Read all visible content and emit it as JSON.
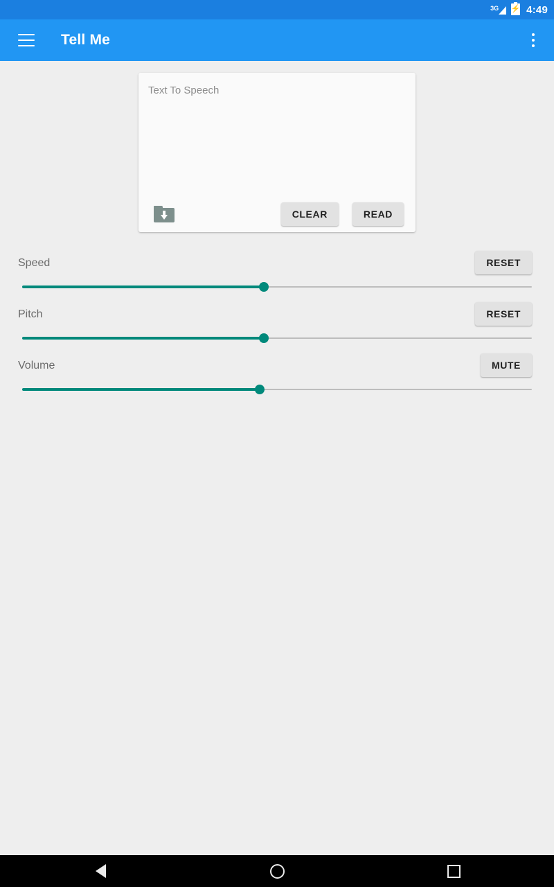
{
  "status_bar": {
    "network_label": "3G",
    "network_icon": "signal-3g-icon",
    "battery_icon": "battery-charging-icon",
    "time": "4:49",
    "background_color": "#1b7fe0"
  },
  "app_bar": {
    "menu_icon": "hamburger-menu-icon",
    "title": "Tell Me",
    "overflow_icon": "overflow-menu-icon",
    "background_color": "#2196f3"
  },
  "card": {
    "input": {
      "placeholder": "Text To Speech",
      "value": ""
    },
    "load_icon": "folder-download-icon",
    "clear_label": "CLEAR",
    "read_label": "READ"
  },
  "sliders": [
    {
      "label": "Speed",
      "button_label": "RESET",
      "value_percent": 47.4,
      "track_color": "#00897b",
      "inactive_color": "#bdbdbd"
    },
    {
      "label": "Pitch",
      "button_label": "RESET",
      "value_percent": 47.4,
      "track_color": "#00897b",
      "inactive_color": "#bdbdbd"
    },
    {
      "label": "Volume",
      "button_label": "MUTE",
      "value_percent": 46.6,
      "track_color": "#00897b",
      "inactive_color": "#bdbdbd"
    }
  ],
  "nav_bar": {
    "back_icon": "navigation-back-icon",
    "home_icon": "navigation-home-icon",
    "recents_icon": "navigation-recents-icon"
  }
}
